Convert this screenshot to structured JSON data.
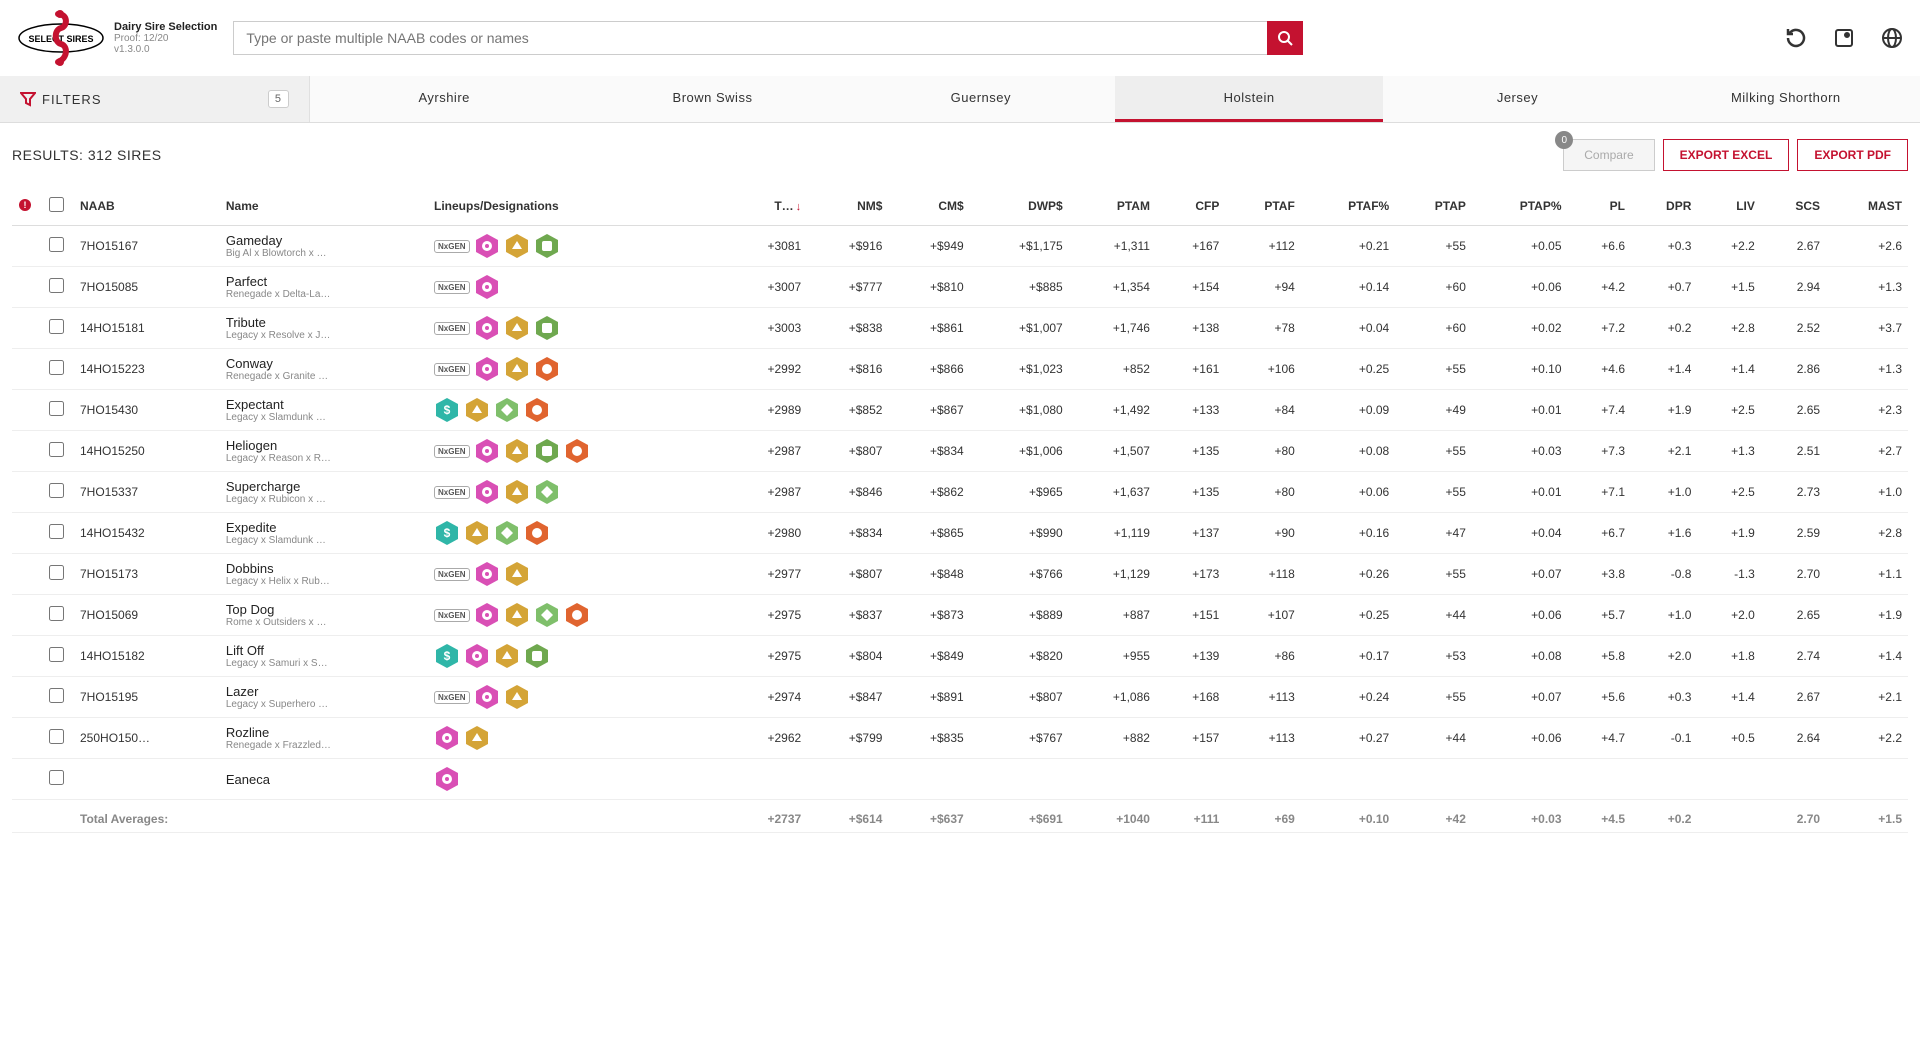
{
  "header": {
    "app_title": "Dairy Sire Selection",
    "proof": "Proof: 12/20",
    "version": "v1.3.0.0",
    "search_placeholder": "Type or paste multiple NAAB codes or names"
  },
  "filters": {
    "label": "FILTERS",
    "count": "5"
  },
  "breeds": [
    "Ayrshire",
    "Brown Swiss",
    "Guernsey",
    "Holstein",
    "Jersey",
    "Milking Shorthorn"
  ],
  "active_breed": "Holstein",
  "results": {
    "label_prefix": "RESULTS: ",
    "count": "312",
    "label_suffix": " SIRES"
  },
  "actions": {
    "compare": "Compare",
    "compare_count": "0",
    "excel": "EXPORT EXCEL",
    "pdf": "EXPORT PDF"
  },
  "columns": [
    "NAAB",
    "Name",
    "Lineups/Designations",
    "T…",
    "NM$",
    "CM$",
    "DWP$",
    "PTAM",
    "CFP",
    "PTAF",
    "PTAF%",
    "PTAP",
    "PTAP%",
    "PL",
    "DPR",
    "LIV",
    "SCS",
    "MAST"
  ],
  "sorted_col": "T…",
  "rows": [
    {
      "naab": "7HO15167",
      "name": "Gameday",
      "sub": "Big Al x Blowtorch x …",
      "badges": [
        "nxgen",
        "pink",
        "gold",
        "green"
      ],
      "t": "+3081",
      "nm": "+$916",
      "cm": "+$949",
      "dwp": "+$1,175",
      "ptam": "+1,311",
      "cfp": "+167",
      "ptaf": "+112",
      "ptafp": "+0.21",
      "ptap": "+55",
      "ptapp": "+0.05",
      "pl": "+6.6",
      "dpr": "+0.3",
      "liv": "+2.2",
      "scs": "2.67",
      "mast": "+2.6"
    },
    {
      "naab": "7HO15085",
      "name": "Parfect",
      "sub": "Renegade x Delta-La…",
      "badges": [
        "nxgen",
        "pink"
      ],
      "t": "+3007",
      "nm": "+$777",
      "cm": "+$810",
      "dwp": "+$885",
      "ptam": "+1,354",
      "cfp": "+154",
      "ptaf": "+94",
      "ptafp": "+0.14",
      "ptap": "+60",
      "ptapp": "+0.06",
      "pl": "+4.2",
      "dpr": "+0.7",
      "liv": "+1.5",
      "scs": "2.94",
      "mast": "+1.3"
    },
    {
      "naab": "14HO15181",
      "name": "Tribute",
      "sub": "Legacy x Resolve x J…",
      "badges": [
        "nxgen",
        "pink",
        "gold",
        "green"
      ],
      "t": "+3003",
      "nm": "+$838",
      "cm": "+$861",
      "dwp": "+$1,007",
      "ptam": "+1,746",
      "cfp": "+138",
      "ptaf": "+78",
      "ptafp": "+0.04",
      "ptap": "+60",
      "ptapp": "+0.02",
      "pl": "+7.2",
      "dpr": "+0.2",
      "liv": "+2.8",
      "scs": "2.52",
      "mast": "+3.7"
    },
    {
      "naab": "14HO15223",
      "name": "Conway",
      "sub": "Renegade x Granite …",
      "badges": [
        "nxgen",
        "pink",
        "gold",
        "orange"
      ],
      "t": "+2992",
      "nm": "+$816",
      "cm": "+$866",
      "dwp": "+$1,023",
      "ptam": "+852",
      "cfp": "+161",
      "ptaf": "+106",
      "ptafp": "+0.25",
      "ptap": "+55",
      "ptapp": "+0.10",
      "pl": "+4.6",
      "dpr": "+1.4",
      "liv": "+1.4",
      "scs": "2.86",
      "mast": "+1.3"
    },
    {
      "naab": "7HO15430",
      "name": "Expectant",
      "sub": "Legacy x Slamdunk …",
      "badges": [
        "teal",
        "gold",
        "green2",
        "orange"
      ],
      "t": "+2989",
      "nm": "+$852",
      "cm": "+$867",
      "dwp": "+$1,080",
      "ptam": "+1,492",
      "cfp": "+133",
      "ptaf": "+84",
      "ptafp": "+0.09",
      "ptap": "+49",
      "ptapp": "+0.01",
      "pl": "+7.4",
      "dpr": "+1.9",
      "liv": "+2.5",
      "scs": "2.65",
      "mast": "+2.3"
    },
    {
      "naab": "14HO15250",
      "name": "Heliogen",
      "sub": "Legacy x Reason x R…",
      "badges": [
        "nxgen",
        "pink",
        "gold",
        "green",
        "orange"
      ],
      "t": "+2987",
      "nm": "+$807",
      "cm": "+$834",
      "dwp": "+$1,006",
      "ptam": "+1,507",
      "cfp": "+135",
      "ptaf": "+80",
      "ptafp": "+0.08",
      "ptap": "+55",
      "ptapp": "+0.03",
      "pl": "+7.3",
      "dpr": "+2.1",
      "liv": "+1.3",
      "scs": "2.51",
      "mast": "+2.7"
    },
    {
      "naab": "7HO15337",
      "name": "Supercharge",
      "sub": "Legacy x Rubicon x …",
      "badges": [
        "nxgen",
        "pink",
        "gold",
        "green2"
      ],
      "t": "+2987",
      "nm": "+$846",
      "cm": "+$862",
      "dwp": "+$965",
      "ptam": "+1,637",
      "cfp": "+135",
      "ptaf": "+80",
      "ptafp": "+0.06",
      "ptap": "+55",
      "ptapp": "+0.01",
      "pl": "+7.1",
      "dpr": "+1.0",
      "liv": "+2.5",
      "scs": "2.73",
      "mast": "+1.0"
    },
    {
      "naab": "14HO15432",
      "name": "Expedite",
      "sub": "Legacy x Slamdunk …",
      "badges": [
        "teal",
        "gold",
        "green2",
        "orange"
      ],
      "t": "+2980",
      "nm": "+$834",
      "cm": "+$865",
      "dwp": "+$990",
      "ptam": "+1,119",
      "cfp": "+137",
      "ptaf": "+90",
      "ptafp": "+0.16",
      "ptap": "+47",
      "ptapp": "+0.04",
      "pl": "+6.7",
      "dpr": "+1.6",
      "liv": "+1.9",
      "scs": "2.59",
      "mast": "+2.8"
    },
    {
      "naab": "7HO15173",
      "name": "Dobbins",
      "sub": "Legacy x Helix x Rub…",
      "badges": [
        "nxgen",
        "pink",
        "gold"
      ],
      "t": "+2977",
      "nm": "+$807",
      "cm": "+$848",
      "dwp": "+$766",
      "ptam": "+1,129",
      "cfp": "+173",
      "ptaf": "+118",
      "ptafp": "+0.26",
      "ptap": "+55",
      "ptapp": "+0.07",
      "pl": "+3.8",
      "dpr": "-0.8",
      "liv": "-1.3",
      "scs": "2.70",
      "mast": "+1.1"
    },
    {
      "naab": "7HO15069",
      "name": "Top Dog",
      "sub": "Rome x Outsiders x …",
      "badges": [
        "nxgen",
        "pink",
        "gold",
        "green2",
        "orange"
      ],
      "t": "+2975",
      "nm": "+$837",
      "cm": "+$873",
      "dwp": "+$889",
      "ptam": "+887",
      "cfp": "+151",
      "ptaf": "+107",
      "ptafp": "+0.25",
      "ptap": "+44",
      "ptapp": "+0.06",
      "pl": "+5.7",
      "dpr": "+1.0",
      "liv": "+2.0",
      "scs": "2.65",
      "mast": "+1.9"
    },
    {
      "naab": "14HO15182",
      "name": "Lift Off",
      "sub": "Legacy x Samuri x S…",
      "badges": [
        "teal",
        "pink",
        "gold",
        "green"
      ],
      "t": "+2975",
      "nm": "+$804",
      "cm": "+$849",
      "dwp": "+$820",
      "ptam": "+955",
      "cfp": "+139",
      "ptaf": "+86",
      "ptafp": "+0.17",
      "ptap": "+53",
      "ptapp": "+0.08",
      "pl": "+5.8",
      "dpr": "+2.0",
      "liv": "+1.8",
      "scs": "2.74",
      "mast": "+1.4"
    },
    {
      "naab": "7HO15195",
      "name": "Lazer",
      "sub": "Legacy x Superhero …",
      "badges": [
        "nxgen",
        "pink",
        "gold"
      ],
      "t": "+2974",
      "nm": "+$847",
      "cm": "+$891",
      "dwp": "+$807",
      "ptam": "+1,086",
      "cfp": "+168",
      "ptaf": "+113",
      "ptafp": "+0.24",
      "ptap": "+55",
      "ptapp": "+0.07",
      "pl": "+5.6",
      "dpr": "+0.3",
      "liv": "+1.4",
      "scs": "2.67",
      "mast": "+2.1"
    },
    {
      "naab": "250HO150…",
      "name": "Rozline",
      "sub": "Renegade x Frazzled…",
      "badges": [
        "pink",
        "gold"
      ],
      "t": "+2962",
      "nm": "+$799",
      "cm": "+$835",
      "dwp": "+$767",
      "ptam": "+882",
      "cfp": "+157",
      "ptaf": "+113",
      "ptafp": "+0.27",
      "ptap": "+44",
      "ptapp": "+0.06",
      "pl": "+4.7",
      "dpr": "-0.1",
      "liv": "+0.5",
      "scs": "2.64",
      "mast": "+2.2"
    },
    {
      "naab": "",
      "name": "Eaneca",
      "sub": "",
      "badges": [
        "pink"
      ],
      "t": "",
      "nm": "",
      "cm": "",
      "dwp": "",
      "ptam": "",
      "cfp": "",
      "ptaf": "",
      "ptafp": "",
      "ptap": "",
      "ptapp": "",
      "pl": "",
      "dpr": "",
      "liv": "",
      "scs": "",
      "mast": ""
    }
  ],
  "totals": {
    "label": "Total Averages:",
    "t": "+2737",
    "nm": "+$614",
    "cm": "+$637",
    "dwp": "+$691",
    "ptam": "+1040",
    "cfp": "+111",
    "ptaf": "+69",
    "ptafp": "+0.10",
    "ptap": "+42",
    "ptapp": "+0.03",
    "pl": "+4.5",
    "dpr": "+0.2",
    "liv": "",
    "scs": "2.70",
    "mast": "+1.5"
  }
}
